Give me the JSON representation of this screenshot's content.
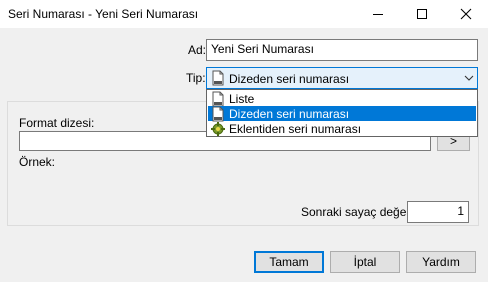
{
  "window": {
    "title": "Seri Numarası - Yeni Seri Numarası"
  },
  "form": {
    "ad_label": "Ad:",
    "ad_value": "Yeni Seri Numarası",
    "tip_label": "Tip:",
    "tip_value": "Dizeden seri numarası",
    "format_label": "Format dizesi:",
    "format_value": "",
    "browse_label": ">",
    "ornek_label": "Örnek:",
    "counter_label": "Sonraki sayaç değeri:",
    "counter_value": "1"
  },
  "dropdown": {
    "items": [
      {
        "label": "Liste",
        "icon": "document-icon",
        "selected": false
      },
      {
        "label": "Dizeden seri numarası",
        "icon": "document-icon",
        "selected": true
      },
      {
        "label": "Eklentiden seri numarası",
        "icon": "plugin-icon",
        "selected": false
      }
    ]
  },
  "buttons": {
    "ok": "Tamam",
    "cancel": "İptal",
    "help": "Yardım"
  },
  "colors": {
    "accent": "#0078d7",
    "selected_bg": "#e5f1fb"
  }
}
